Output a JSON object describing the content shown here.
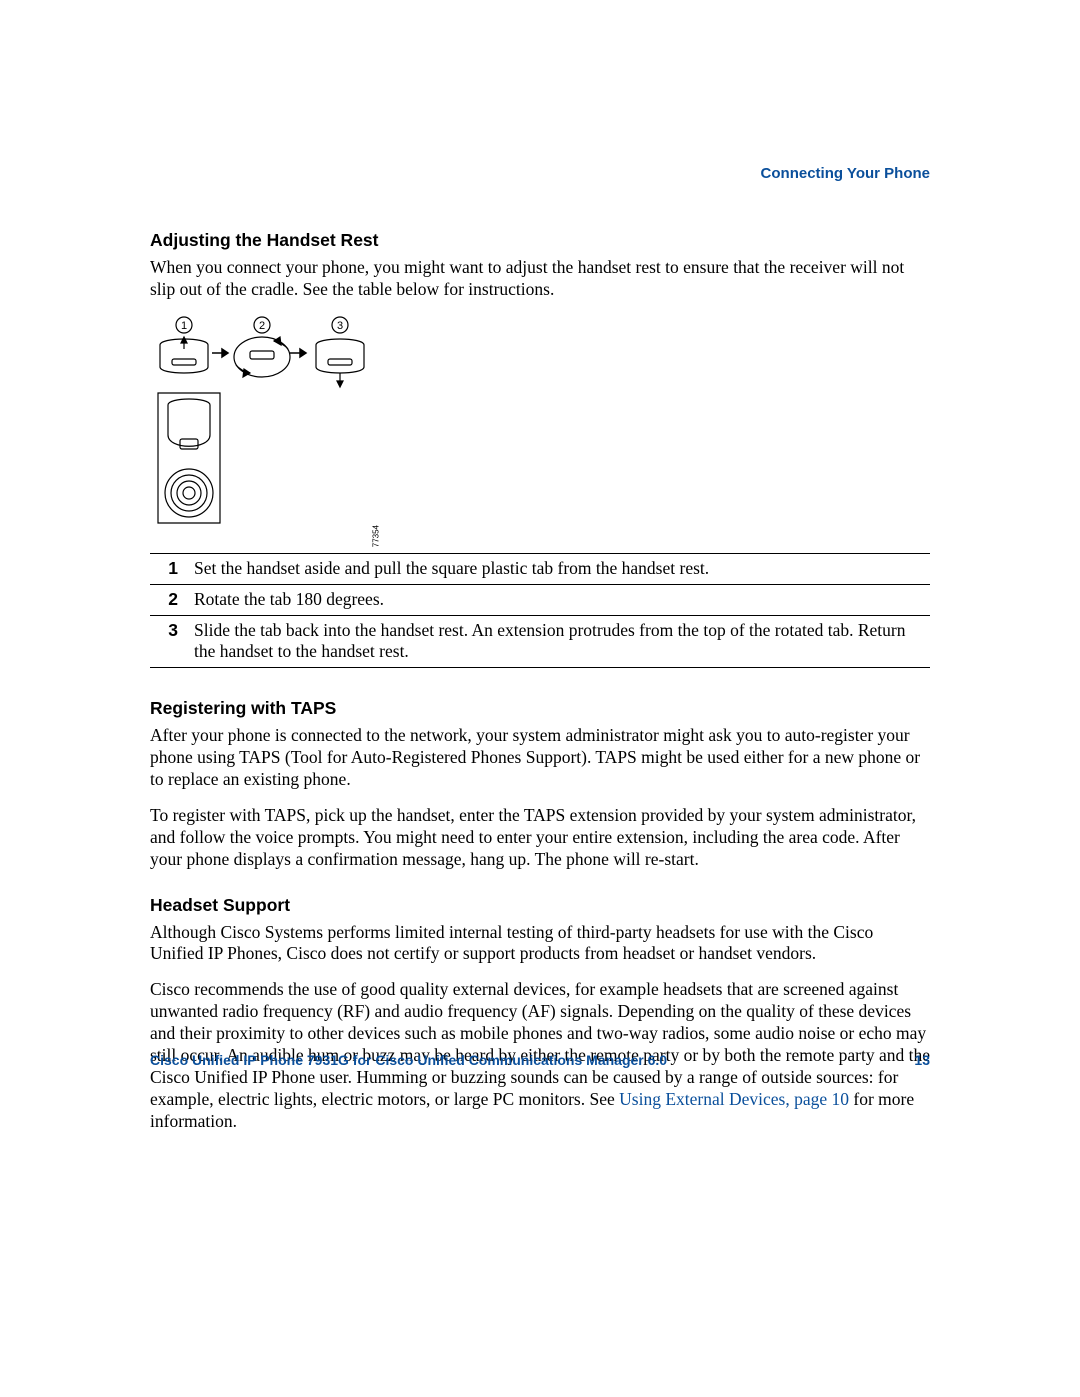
{
  "header": {
    "running_title": "Connecting Your Phone"
  },
  "sections": {
    "s1": {
      "heading": "Adjusting the Handset Rest",
      "p1": "When you connect your phone, you might want to adjust the handset rest to ensure that the receiver will not slip out of the cradle. See the table below for instructions."
    },
    "figure": {
      "label": "77354",
      "callouts": {
        "c1": "1",
        "c2": "2",
        "c3": "3"
      }
    },
    "steps_table": {
      "rows": [
        {
          "num": "1",
          "text": "Set the handset aside and pull the square plastic tab from the handset rest."
        },
        {
          "num": "2",
          "text": "Rotate the tab 180 degrees."
        },
        {
          "num": "3",
          "text": "Slide the tab back into the handset rest. An extension protrudes from the top of the rotated tab. Return the handset to the handset rest."
        }
      ]
    },
    "s2": {
      "heading": "Registering with TAPS",
      "p1": "After your phone is connected to the network, your system administrator might ask you to auto-register your phone using TAPS (Tool for Auto-Registered Phones Support). TAPS might be used either for a new phone or to replace an existing phone.",
      "p2": "To register with TAPS, pick up the handset, enter the TAPS extension provided by your system administrator, and follow the voice prompts. You might need to enter your entire extension, including the area code. After your phone displays a confirmation message, hang up. The phone will re-start."
    },
    "s3": {
      "heading": "Headset Support",
      "p1": "Although Cisco Systems performs limited internal testing of third-party headsets for use with the Cisco Unified IP Phones, Cisco does not certify or support products from headset or handset vendors.",
      "p2_a": "Cisco recommends the use of good quality external devices, for example headsets that are screened against unwanted radio frequency (RF) and audio frequency (AF) signals. Depending on the quality of these devices and their proximity to other devices such as mobile phones and two-way radios, some audio noise or echo may still occur. An audible hum or buzz may be heard by either the remote party or by both the remote party and the Cisco Unified IP Phone user. Humming or buzzing sounds can be caused by a range of outside sources: for example, electric lights, electric motors, or large PC monitors. See ",
      "p2_link": "Using External Devices, page 10",
      "p2_b": " for more information."
    }
  },
  "footer": {
    "title": "Cisco Unified IP Phone 7931G for Cisco Unified Communications Manager 6.0",
    "page_number": "13"
  }
}
